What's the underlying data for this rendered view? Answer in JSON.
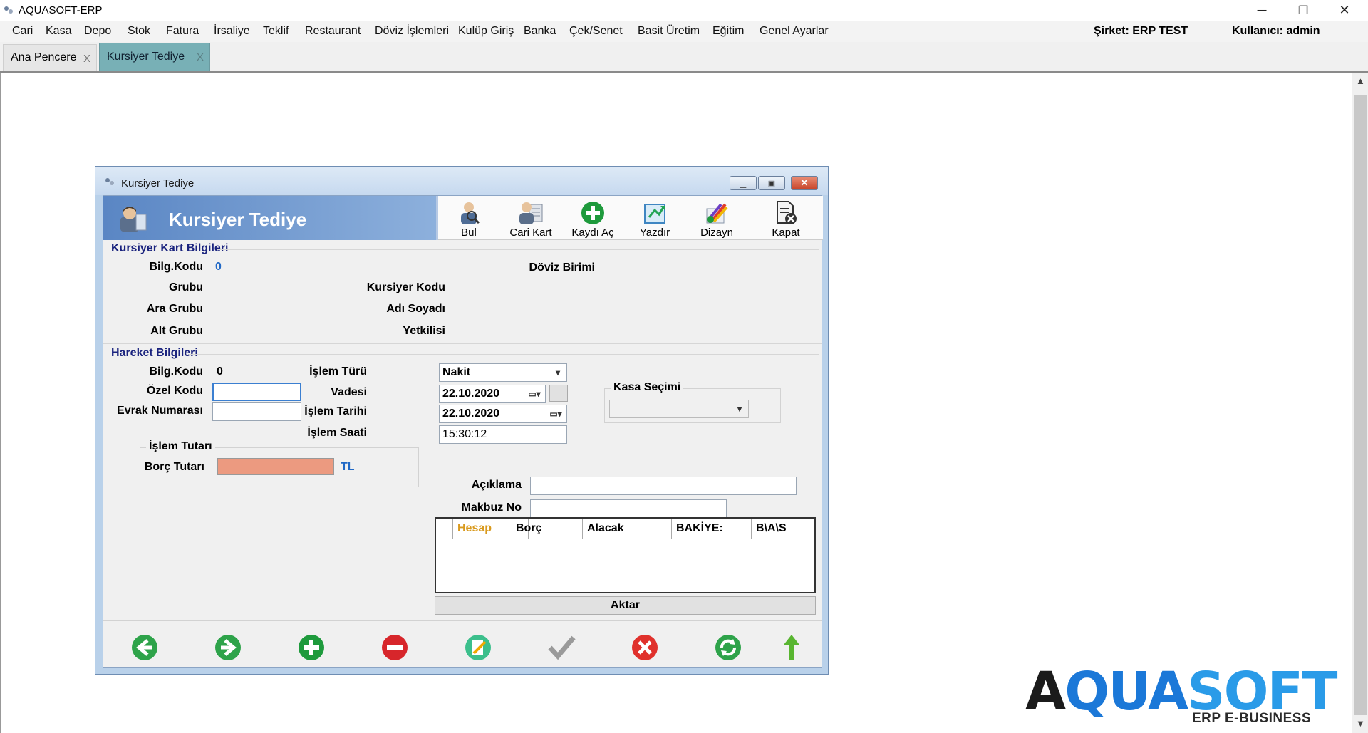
{
  "app": {
    "title": "AQUASOFT-ERP"
  },
  "window_controls": {
    "minimize": "─",
    "restore": "❐",
    "close": "✕"
  },
  "menu": {
    "items": [
      "Cari",
      "Kasa",
      "Depo",
      "Stok",
      "Fatura",
      "İrsaliye",
      "Teklif",
      "Restaurant",
      "Döviz İşlemleri",
      "Kulüp Giriş",
      "Banka",
      "Çek/Senet",
      "Basit Üretim",
      "Eğitim",
      "Genel Ayarlar"
    ],
    "company": "Şirket: ERP TEST",
    "user": "Kullanıcı: admin"
  },
  "tabs": [
    {
      "label": "Ana Pencere",
      "close": "X",
      "active": false
    },
    {
      "label": "Kursiyer Tediye",
      "close": "X",
      "active": true
    }
  ],
  "form": {
    "window_title": "Kursiyer Tediye",
    "banner_title": "Kursiyer Tediye",
    "toolbar": {
      "find": "Bul",
      "account_card": "Cari Kart",
      "open_record": "Kaydı Aç",
      "print": "Yazdır",
      "design": "Dizayn",
      "close": "Kapat"
    },
    "card_section": {
      "title": "Kursiyer Kart Bilgileri",
      "bilg_kodu_label": "Bilg.Kodu",
      "bilg_kodu_value": "0",
      "group_label": "Grubu",
      "mid_group_label": "Ara Grubu",
      "sub_group_label": "Alt Grubu",
      "trainee_code_label": "Kursiyer Kodu",
      "full_name_label": "Adı Soyadı",
      "authorized_label": "Yetkilisi",
      "currency_label": "Döviz Birimi"
    },
    "movement_section": {
      "title": "Hareket Bilgileri",
      "bilg_kodu_label": "Bilg.Kodu",
      "bilg_kodu_value": "0",
      "special_code_label": "Özel Kodu",
      "special_code_value": "",
      "document_no_label": "Evrak Numarası",
      "document_no_value": "",
      "transaction_type_label": "İşlem Türü",
      "transaction_type_value": "Nakit",
      "due_date_label": "Vadesi",
      "due_date_value": "22.10.2020",
      "transaction_date_label": "İşlem Tarihi",
      "transaction_date_value": "22.10.2020",
      "transaction_time_label": "İşlem Saati",
      "transaction_time_value": "15:30:12",
      "cash_selection_title": "Kasa Seçimi",
      "cash_selection_value": "",
      "amount_group_title": "İşlem Tutarı",
      "debit_amount_label": "Borç Tutarı",
      "debit_amount_value": "",
      "currency_unit": "TL",
      "description_label": "Açıklama",
      "description_value": "",
      "receipt_no_label": "Makbuz No",
      "receipt_no_value": ""
    },
    "grid": {
      "columns": [
        "Hesap",
        "Borç",
        "Alacak",
        "BAKİYE:",
        "B\\A\\S"
      ],
      "rows": []
    },
    "transfer_button": "Aktar",
    "colors": {
      "debit_field": "#ec9a80",
      "accent_blue": "#2169c6",
      "section_title": "#1a237e",
      "hesap_header": "#d99a1e"
    }
  },
  "logo": {
    "text_dark": "A",
    "text_blue_1": "QUA",
    "text_blue_2": "SOFT",
    "subtitle": "ERP E-BUSINESS"
  }
}
